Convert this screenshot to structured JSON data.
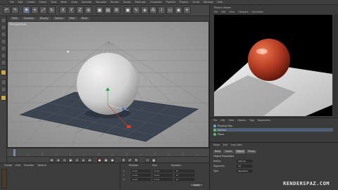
{
  "menubar": {
    "items": [
      "File",
      "Edit",
      "Create",
      "Select",
      "Tools",
      "Mesh",
      "Snap",
      "Animate",
      "Simulate",
      "Render",
      "Sculpt",
      "MoGraph",
      "Character",
      "Pipeline",
      "Plugins",
      "Script",
      "Window",
      "Help"
    ]
  },
  "viewport": {
    "tabs": [
      "View",
      "Cameras",
      "Display",
      "Options",
      "Filter",
      "Panel"
    ],
    "title": "Perspective",
    "colors": {
      "floor": "#3b4552",
      "bg": "#9c9c9c",
      "sphere": "#d9d9d9"
    }
  },
  "render_view": {
    "title": "Picture Viewer",
    "menu": [
      "File",
      "Edit",
      "View",
      "Compare",
      "Animation"
    ],
    "colors": {
      "bg": "#000000",
      "floor": "#dcdcdc",
      "sphere": "#c0392b"
    }
  },
  "objects": {
    "menu": [
      "File",
      "Edit",
      "View",
      "Objects",
      "Tags",
      "Bookmarks"
    ],
    "items": [
      {
        "label": "Physical Sky",
        "color": "#6aa0d8"
      },
      {
        "label": "Sphere",
        "color": "#5ac06a"
      },
      {
        "label": "Plane",
        "color": "#5ac06a"
      }
    ]
  },
  "attributes": {
    "tabs": [
      "Mode",
      "Edit",
      "User Data"
    ],
    "subtabs": [
      "Basic",
      "Coord.",
      "Object",
      "Phong"
    ],
    "section": "Object Properties",
    "rows": [
      {
        "label": "Radius",
        "value": "100 cm"
      },
      {
        "label": "Segments",
        "value": "24"
      },
      {
        "label": "Type",
        "value": "Standard"
      }
    ]
  },
  "coordinates": {
    "headers": [
      "Position",
      "Size",
      "Rotation"
    ],
    "rows": [
      {
        "axis": "X",
        "pos": "0 cm",
        "size": "0 cm",
        "rot": "0 °"
      },
      {
        "axis": "Y",
        "pos": "0 cm",
        "size": "0 cm",
        "rot": "0 °"
      },
      {
        "axis": "Z",
        "pos": "0 cm",
        "size": "0 cm",
        "rot": "0 °"
      }
    ],
    "apply_label": "Apply"
  },
  "materials": {
    "menu": [
      "Create",
      "Edit",
      "Function",
      "Texture"
    ]
  },
  "watermark": "RENDERSPAZ.COM"
}
